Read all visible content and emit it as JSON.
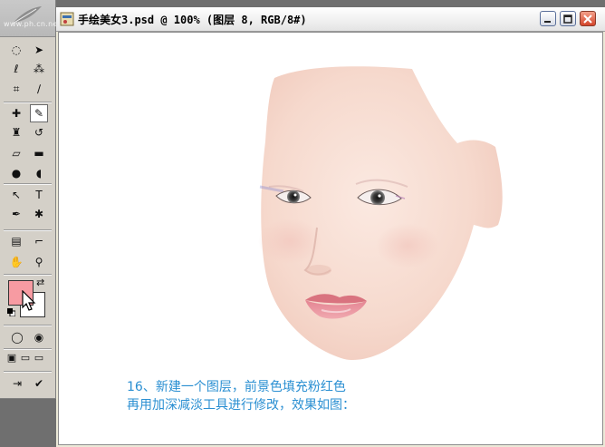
{
  "toolbox": {
    "watermark": "www.ph.cn.net",
    "tools": [
      {
        "name": "marquee-tool",
        "glyph": "◌"
      },
      {
        "name": "move-tool",
        "glyph": "➤"
      },
      {
        "name": "lasso-tool",
        "glyph": "ℓ"
      },
      {
        "name": "magic-wand-tool",
        "glyph": "⁂"
      },
      {
        "name": "crop-tool",
        "glyph": "⌗"
      },
      {
        "name": "slice-tool",
        "glyph": "∕"
      },
      {
        "name": "healing-brush-tool",
        "glyph": "✚"
      },
      {
        "name": "brush-tool",
        "glyph": "✎"
      },
      {
        "name": "clone-stamp-tool",
        "glyph": "♜"
      },
      {
        "name": "history-brush-tool",
        "glyph": "↺"
      },
      {
        "name": "eraser-tool",
        "glyph": "▱"
      },
      {
        "name": "gradient-tool",
        "glyph": "▬"
      },
      {
        "name": "blur-tool",
        "glyph": "●"
      },
      {
        "name": "dodge-tool",
        "glyph": "◖"
      },
      {
        "name": "path-selection-tool",
        "glyph": "↖"
      },
      {
        "name": "type-tool",
        "glyph": "T"
      },
      {
        "name": "pen-tool",
        "glyph": "✒"
      },
      {
        "name": "custom-shape-tool",
        "glyph": "✱"
      },
      {
        "name": "notes-tool",
        "glyph": "▤"
      },
      {
        "name": "eyedropper-tool",
        "glyph": "⌐"
      },
      {
        "name": "hand-tool",
        "glyph": "✋"
      },
      {
        "name": "zoom-tool",
        "glyph": "⚲"
      },
      {
        "name": "standard-mode-button",
        "glyph": "◯"
      },
      {
        "name": "quick-mask-mode-button",
        "glyph": "◉"
      },
      {
        "name": "screen-mode-standard-button",
        "glyph": "▣"
      },
      {
        "name": "screen-mode-menu-button",
        "glyph": "▭"
      },
      {
        "name": "screen-mode-full-button",
        "glyph": "▭"
      },
      {
        "name": "jump-to-imageready-button",
        "glyph": "⇥"
      },
      {
        "name": "edit-in-imageready-button",
        "glyph": "✔"
      }
    ],
    "foreground_color": "#f79ba2",
    "background_color": "#ffffff"
  },
  "document": {
    "title": "手绘美女3.psd @ 100% (图层 8, RGB/8#)",
    "caption_line1": "16、新建一个图层，前景色填充粉红色",
    "caption_line2": "再用加深减淡工具进行修改，效果如图："
  },
  "colors": {
    "accent_text": "#2a8fd2",
    "face_skin": "#f7dcd2",
    "lip": "#e68d97"
  }
}
